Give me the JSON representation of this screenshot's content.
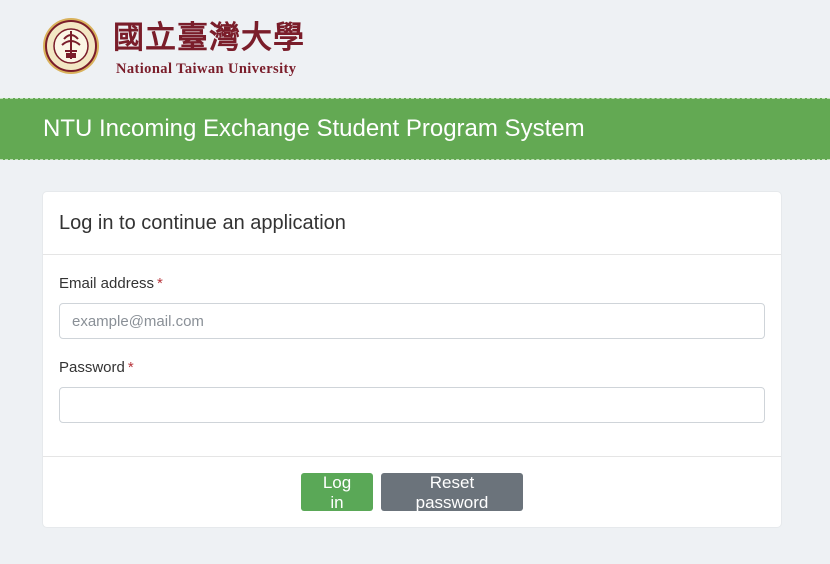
{
  "header": {
    "chinese_name": "國立臺灣大學",
    "english_name": "National Taiwan University"
  },
  "banner": {
    "title": "NTU Incoming Exchange Student Program System"
  },
  "card": {
    "title": "Log in to continue an application",
    "email_label": "Email address",
    "email_required": "*",
    "email_placeholder": "example@mail.com",
    "email_value": "",
    "password_label": "Password",
    "password_required": "*",
    "password_value": "",
    "login_button": "Log in",
    "reset_button": "Reset password"
  },
  "colors": {
    "banner_green": "#63a953",
    "login_green": "#5aa857",
    "reset_gray": "#6b737b",
    "brand_maroon": "#7a1d2a",
    "required_red": "#b7343b"
  }
}
